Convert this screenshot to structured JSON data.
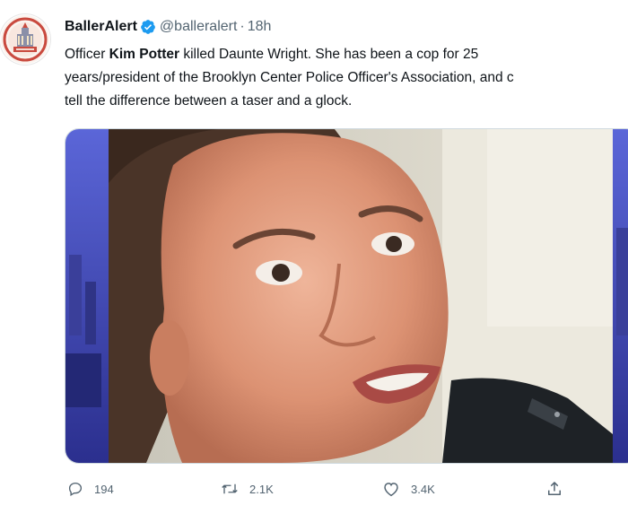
{
  "tweet": {
    "author": {
      "display_name": "BallerAlert",
      "handle": "@balleralert",
      "separator": "·",
      "time": "18h",
      "verified": true,
      "avatar_icon": "balleralert-logo",
      "verified_icon": "verified-badge-icon"
    },
    "text": {
      "l1_a": "Officer ",
      "l1_bold": "Kim Potter",
      "l1_b": " killed Daunte Wright. She has been a cop for 25",
      "l2": "years/president of the Brooklyn Center Police Officer's Association, and c",
      "l3": "tell the difference between a taser and a glock."
    },
    "media": {
      "type": "photo"
    },
    "actions": {
      "reply_count": "194",
      "retweet_count": "2.1K",
      "like_count": "3.4K",
      "reply_icon": "reply-icon",
      "retweet_icon": "retweet-icon",
      "like_icon": "heart-icon",
      "share_icon": "share-icon"
    },
    "colors": {
      "verified": "#1d9bf0",
      "muted": "#536471",
      "text": "#0f1419"
    }
  }
}
